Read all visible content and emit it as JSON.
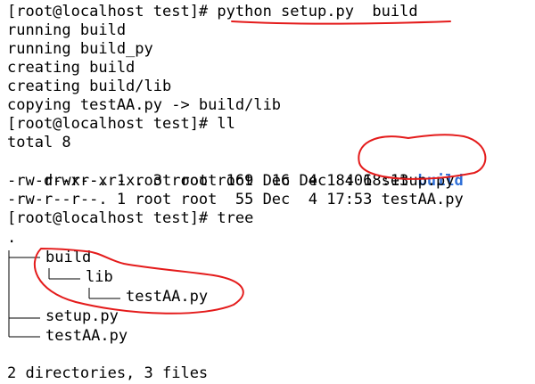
{
  "terminal": {
    "lines": [
      "[root@localhost test]# python setup.py  build",
      "running build",
      "running build_py",
      "creating build",
      "creating build/lib",
      "copying testAA.py -> build/lib",
      "[root@localhost test]# ll",
      "total 8",
      "drwxr-xr-x. 3 root root  16 Dec  4 18:13 ",
      "build",
      "-rw-r--r--. 1 root root 169 Dec  4 18:06 setup.py",
      "-rw-r--r--. 1 root root  55 Dec  4 17:53 testAA.py",
      "[root@localhost test]# tree",
      ".",
      "build",
      "lib",
      "testAA.py",
      "setup.py",
      "testAA.py",
      "2 directories, 3 files"
    ]
  },
  "colors": {
    "background": "#ffffff",
    "text": "#000000",
    "directory": "#2f6fd8",
    "annotation": "#e41b1b"
  }
}
